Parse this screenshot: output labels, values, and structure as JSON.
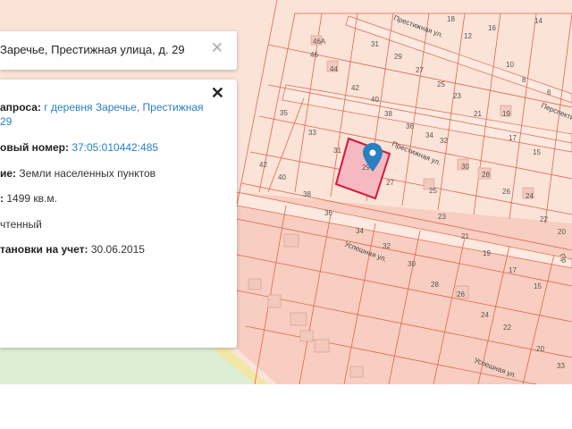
{
  "search": {
    "value": "Заречье, Престижная улица, д. 29",
    "close_glyph": "✕"
  },
  "info": {
    "close_glyph": "✕",
    "request_label": "апроса:",
    "request_value_line1": "г деревня Заречье, Престижная",
    "request_value_line2": "29",
    "cadastral_label": "овый номер:",
    "cadastral_value": "37:05:010442:485",
    "category_label": "ие:",
    "category_value": "Земли населенных пунктов",
    "area_label": ":",
    "area_value": "1499 кв.м.",
    "status_value": "чтенный",
    "date_label": "тановки на учет:",
    "date_value": "30.06.2015"
  },
  "map": {
    "streets": [
      "Престижная ул.",
      "Престижная ул.",
      "Успешная ул.",
      "Успешная ул.",
      "Перспективная ул.",
      "Пр"
    ],
    "selected_plot": "29",
    "plot_numbers": [
      "18",
      "16",
      "14",
      "12",
      "10",
      "8",
      "6",
      "31",
      "29",
      "27",
      "25",
      "23",
      "21",
      "19",
      "17",
      "15",
      "46А",
      "46",
      "44",
      "42",
      "40",
      "38",
      "36",
      "34",
      "32",
      "30",
      "28",
      "26",
      "24",
      "22",
      "20",
      "35",
      "33",
      "31",
      "29",
      "27",
      "25",
      "23",
      "21",
      "19",
      "17",
      "15",
      "42",
      "40",
      "38",
      "36",
      "34",
      "32",
      "30",
      "28",
      "26",
      "24",
      "22",
      "20",
      "33"
    ],
    "colors": {
      "background": "#fbe3d8",
      "parcel_stroke": "#e0664d",
      "block_fill": "#f4c2b4",
      "selected_fill": "#f6b9c1",
      "selected_stroke": "#d6173a",
      "marker": "#2a7fc1",
      "green": "#dcefd4"
    },
    "marker_icon": "map-pin-icon"
  }
}
